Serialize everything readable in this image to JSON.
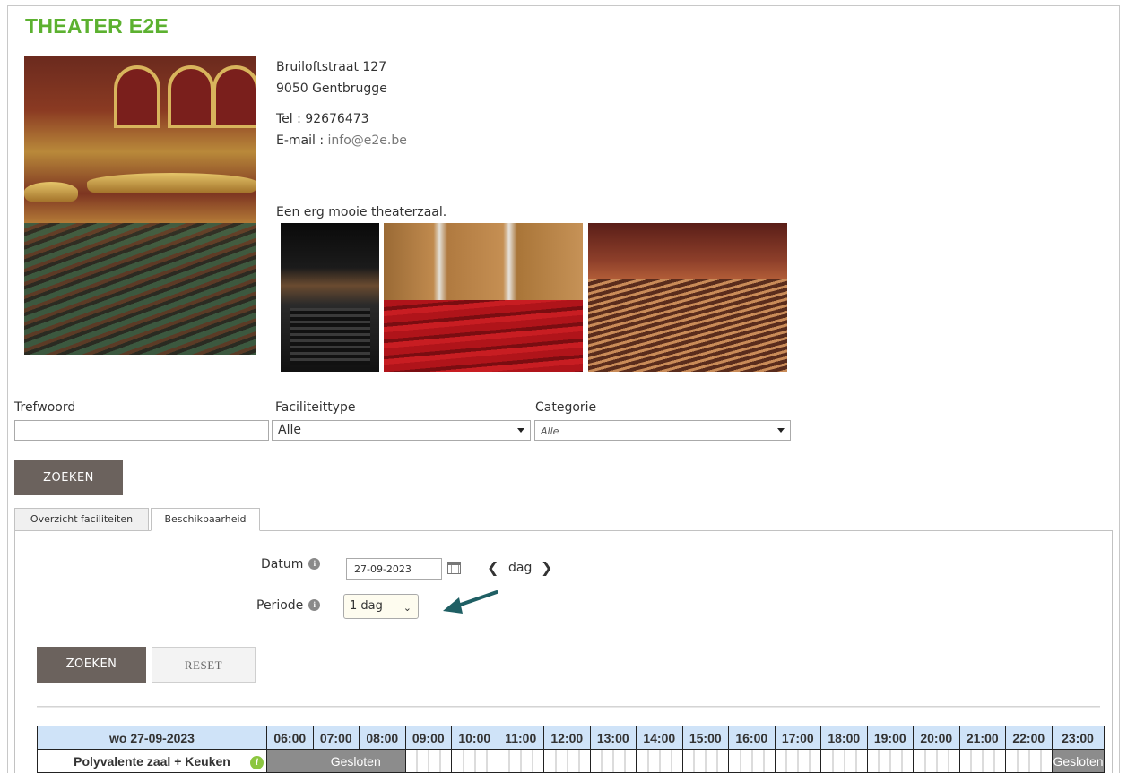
{
  "header": {
    "title": "THEATER E2E"
  },
  "venue": {
    "street": "Bruiloftstraat 127",
    "city": "9050 Gentbrugge",
    "phone_label": "Tel :",
    "phone": "92676473",
    "email_label": "E-mail :",
    "email": "info@e2e.be",
    "description": "Een erg mooie theaterzaal."
  },
  "filters": {
    "keyword_label": "Trefwoord",
    "keyword_value": "",
    "facility_type_label": "Faciliteittype",
    "facility_type_value": "Alle",
    "category_label": "Categorie",
    "category_value": "Alle",
    "search_button": "ZOEKEN"
  },
  "tabs": [
    {
      "label": "Overzicht faciliteiten",
      "active": false
    },
    {
      "label": "Beschikbaarheid",
      "active": true
    }
  ],
  "availability": {
    "date_label": "Datum",
    "date_value": "27-09-2023",
    "step_label": "dag",
    "period_label": "Periode",
    "period_value": "1 dag",
    "search_button": "ZOEKEN",
    "reset_button": "RESET"
  },
  "schedule": {
    "date_header": "wo 27-09-2023",
    "hours": [
      "06:00",
      "07:00",
      "08:00",
      "09:00",
      "10:00",
      "11:00",
      "12:00",
      "13:00",
      "14:00",
      "15:00",
      "16:00",
      "17:00",
      "18:00",
      "19:00",
      "20:00",
      "21:00",
      "22:00",
      "23:00"
    ],
    "rows": [
      {
        "room": "Polyvalente zaal + Keuken",
        "closed_start_label": "Gesloten",
        "closed_end_label": "Gesloten"
      }
    ]
  },
  "icons": {
    "info": "info-icon",
    "calendar": "calendar-icon",
    "prev": "chevron-left-icon",
    "next": "chevron-right-icon",
    "room_info": "info-leaf-icon",
    "annotation": "arrow-icon"
  },
  "colors": {
    "brand_green": "#5cb130",
    "button_dark": "#6b625d",
    "grid_header": "#cfe3f8",
    "closed": "#8c8c8c",
    "annotation_arrow": "#1f5f64"
  }
}
